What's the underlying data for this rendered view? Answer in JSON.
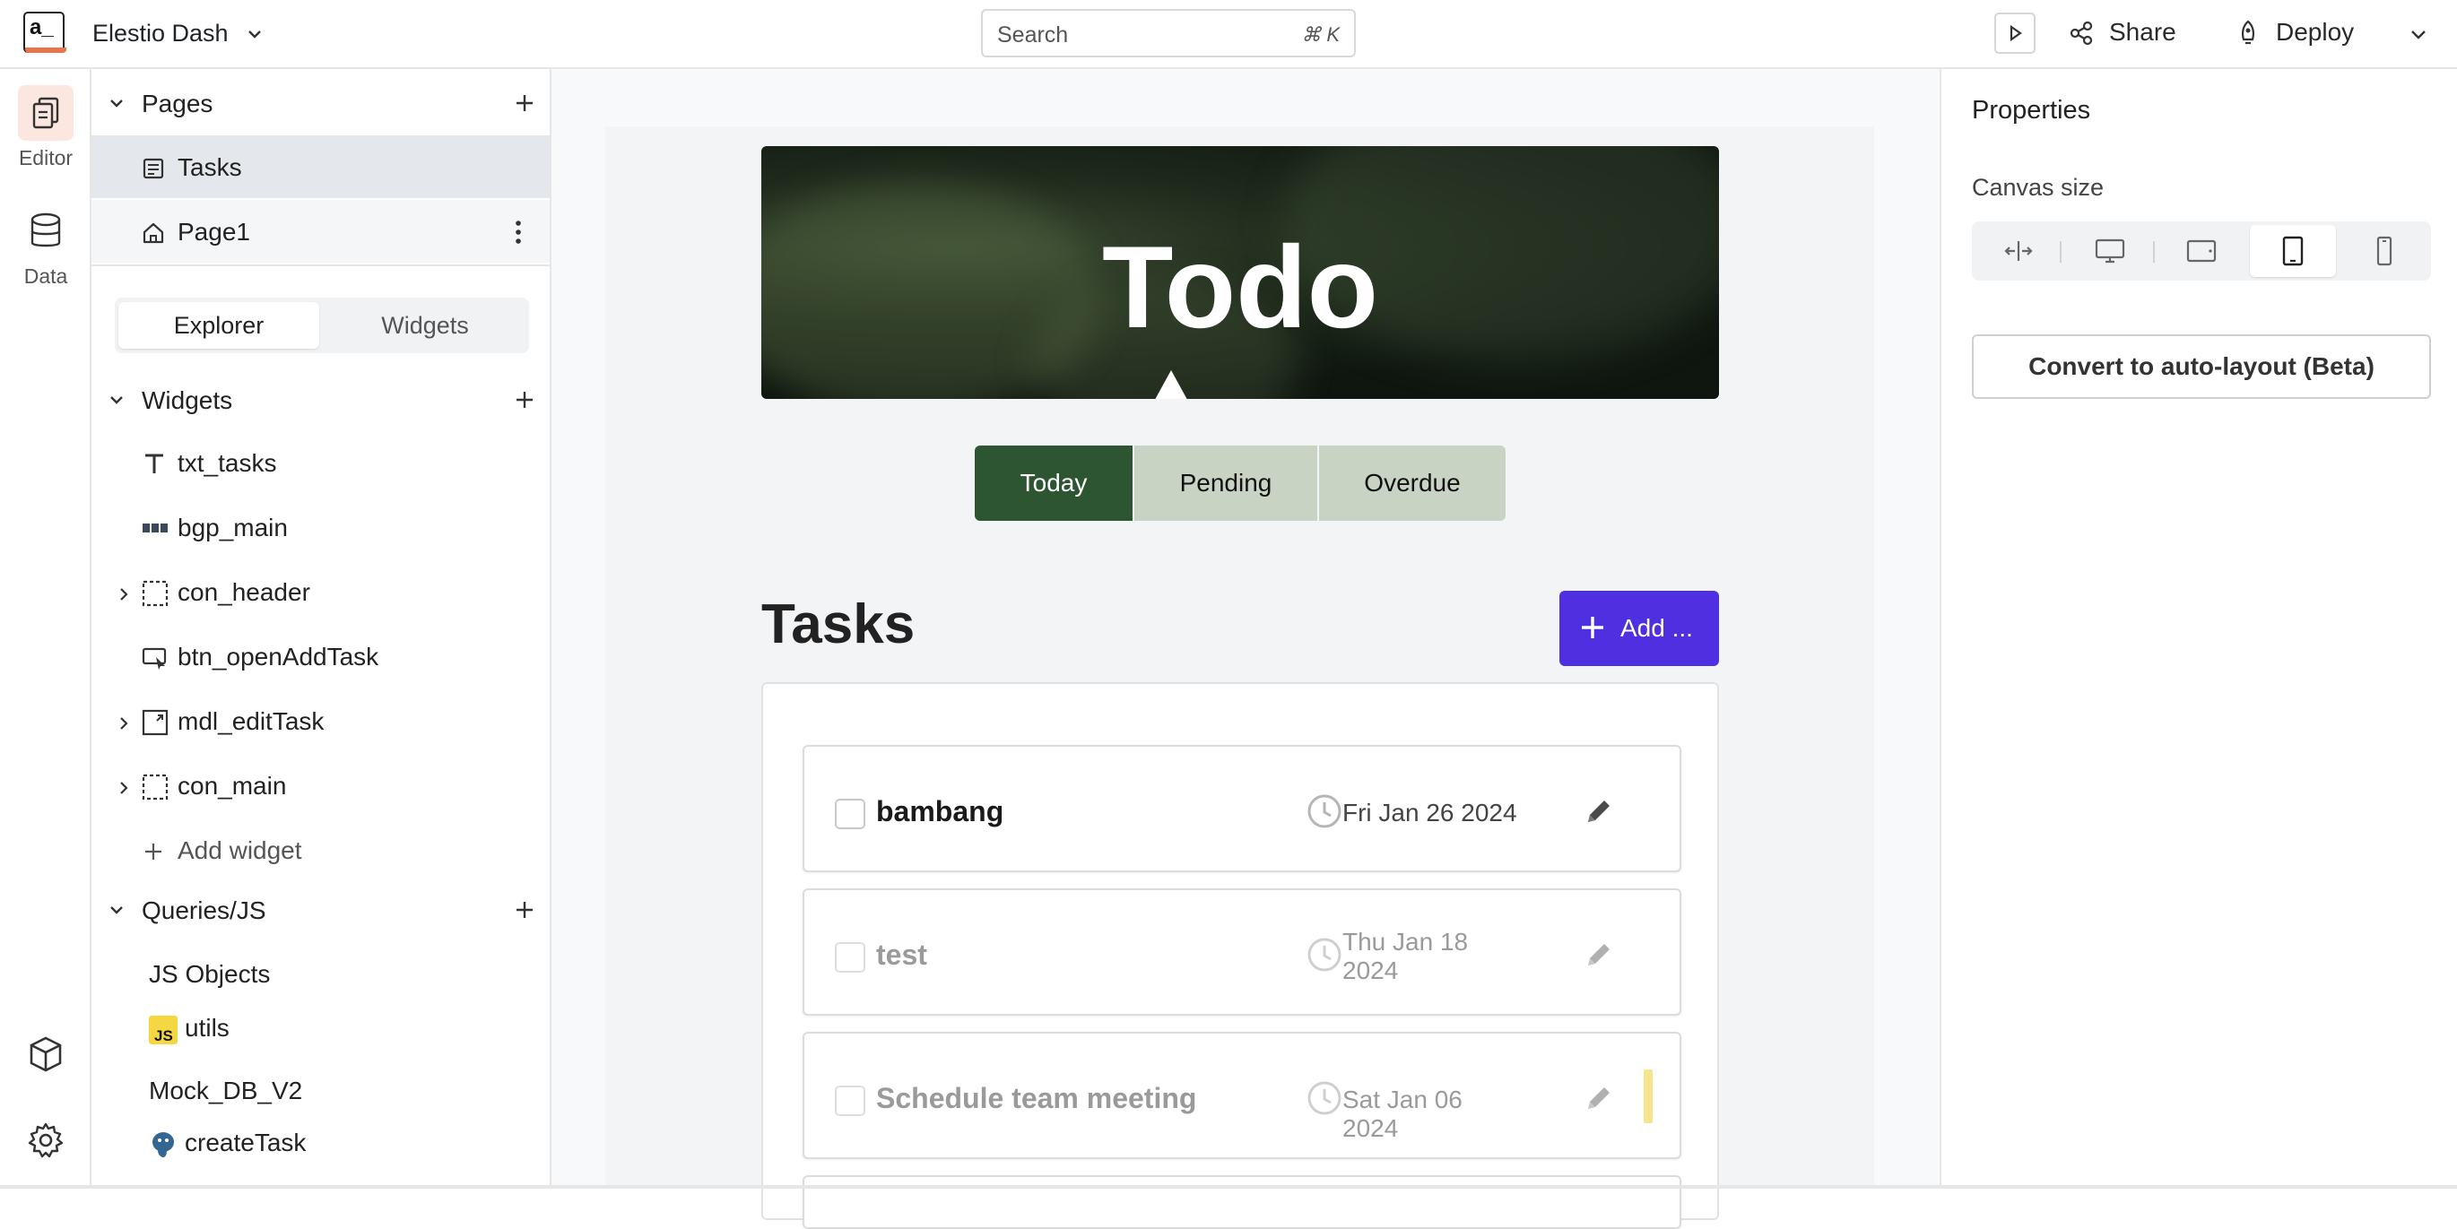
{
  "topbar": {
    "logo_text": "a_",
    "app_name": "Elestio Dash",
    "search_placeholder": "Search",
    "search_shortcut": "⌘ K",
    "share_label": "Share",
    "deploy_label": "Deploy"
  },
  "rail": {
    "editor_label": "Editor",
    "data_label": "Data"
  },
  "sidebar": {
    "pages_title": "Pages",
    "pages": [
      {
        "label": "Tasks",
        "selected": true
      },
      {
        "label": "Page1",
        "home": true
      }
    ],
    "tabs": [
      "Explorer",
      "Widgets"
    ],
    "active_tab": "Explorer",
    "widgets_title": "Widgets",
    "widgets": [
      {
        "label": "txt_tasks",
        "icon": "text-icon"
      },
      {
        "label": "bgp_main",
        "icon": "button-group-icon"
      },
      {
        "label": "con_header",
        "icon": "container-icon",
        "expandable": true
      },
      {
        "label": "btn_openAddTask",
        "icon": "button-icon"
      },
      {
        "label": "mdl_editTask",
        "icon": "modal-icon",
        "expandable": true
      },
      {
        "label": "con_main",
        "icon": "container-icon",
        "expandable": true
      }
    ],
    "add_widget_label": "Add widget",
    "queries_title": "Queries/JS",
    "js_objects_label": "JS Objects",
    "js_items": [
      {
        "label": "utils",
        "icon": "js-icon"
      }
    ],
    "datasource_label": "Mock_DB_V2",
    "queries": [
      {
        "label": "createTask",
        "icon": "postgres-icon"
      }
    ]
  },
  "canvas": {
    "hero_title": "Todo",
    "filters": [
      "Today",
      "Pending",
      "Overdue"
    ],
    "active_filter": "Today",
    "tasks_heading": "Tasks",
    "add_button_label": "Add ...",
    "accent_color": "#4f2fe0",
    "filter_active_color": "#2e5532",
    "tasks": [
      {
        "name": "bambang",
        "date": "Fri Jan 26 2024",
        "dim": false
      },
      {
        "name": "test",
        "date": "Thu Jan 18 2024",
        "dim": true
      },
      {
        "name": "Schedule team meeting",
        "date": "Sat Jan 06 2024",
        "dim": true,
        "flag_color": "#f6e58d"
      }
    ]
  },
  "properties": {
    "title": "Properties",
    "canvas_size_label": "Canvas size",
    "size_options": [
      "fluid-icon",
      "desktop-icon",
      "tablet-landscape-icon",
      "tablet-icon",
      "mobile-icon"
    ],
    "active_size": "tablet-icon",
    "convert_button_label": "Convert to auto-layout (Beta)"
  }
}
